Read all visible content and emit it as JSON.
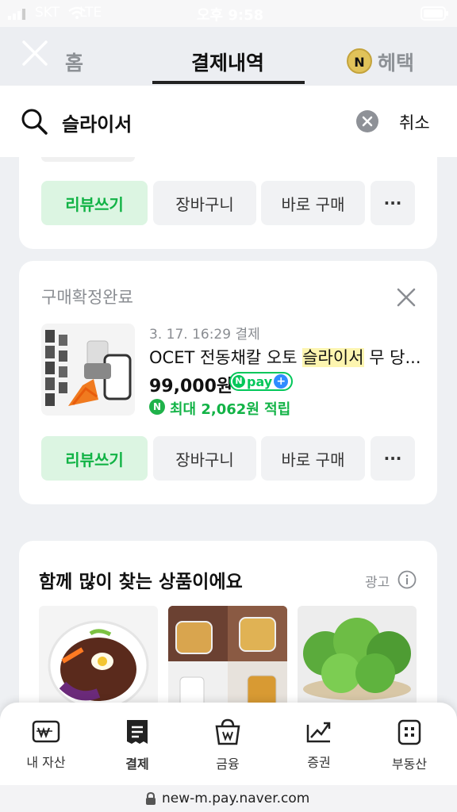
{
  "status_bar": {
    "carrier": "SKT",
    "network": "LTE",
    "time": "오후 9:58"
  },
  "header": {
    "tabs": {
      "home": "홈",
      "payment_history": "결제내역",
      "benefits": "헤택"
    },
    "coin_label": "N"
  },
  "search": {
    "query": "슬라이서",
    "cancel_label": "취소"
  },
  "card_top": {
    "buttons": {
      "review": "리뷰쓰기",
      "cart": "장바구니",
      "buy_now": "바로 구매",
      "more": "···"
    }
  },
  "order": {
    "status": "구매확정완료",
    "date_line": "3. 17. 16:29 결제",
    "title_prefix": "OCET 전동채칼 오토 ",
    "title_highlight": "슬라이서",
    "title_suffix": " 무 당...",
    "price": "99,000원",
    "npay_label": "pay",
    "points": "최대 2,062원 적립",
    "buttons": {
      "review": "리뷰쓰기",
      "cart": "장바구니",
      "buy_now": "바로 구매",
      "more": "···"
    }
  },
  "recommend": {
    "title": "함께 많이 찾는 상품이에요",
    "ad_label": "광고"
  },
  "bottom_nav": [
    {
      "label": "내 자산",
      "icon": "wallet-won-icon"
    },
    {
      "label": "결제",
      "icon": "receipt-icon"
    },
    {
      "label": "금융",
      "icon": "bag-won-icon"
    },
    {
      "label": "증권",
      "icon": "chart-up-icon"
    },
    {
      "label": "부동산",
      "icon": "building-icon"
    }
  ],
  "url_bar": {
    "url": "new-m.pay.naver.com"
  },
  "colors": {
    "accent_green": "#12b346",
    "highlight_yellow": "#fdf5b0",
    "npay_green": "#03c75a"
  }
}
